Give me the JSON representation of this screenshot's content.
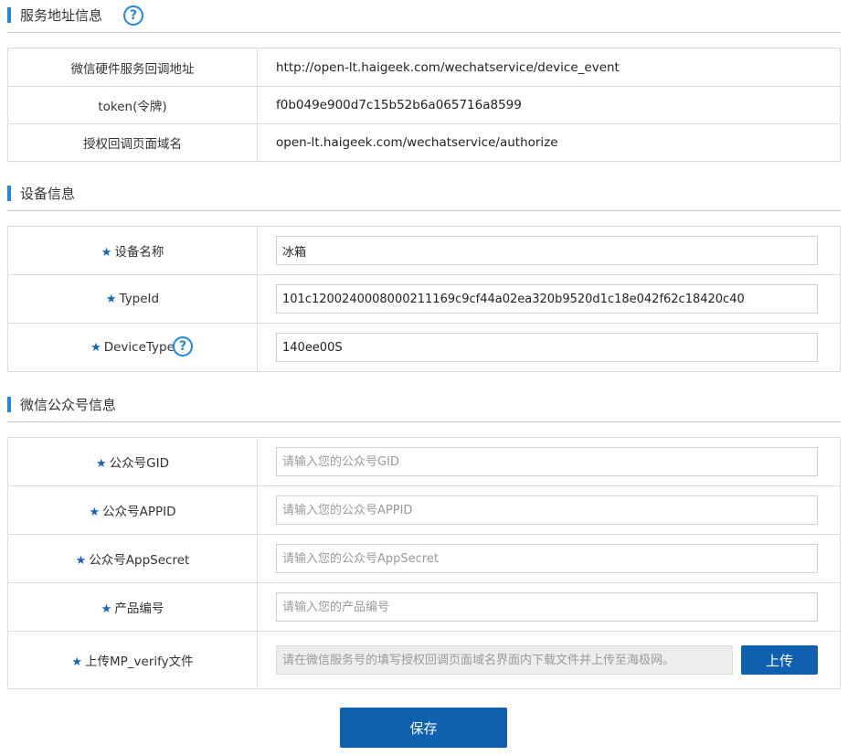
{
  "service": {
    "title": "服务地址信息",
    "rows": [
      {
        "label": "微信硬件服务回调地址",
        "value": "http://open-lt.haigeek.com/wechatservice/device_event"
      },
      {
        "label": "token(令牌)",
        "value": "f0b049e900d7c15b52b6a065716a8599"
      },
      {
        "label": "授权回调页面域名",
        "value": "open-lt.haigeek.com/wechatservice/authorize"
      }
    ]
  },
  "device": {
    "title": "设备信息",
    "name_label": "设备名称",
    "name_value": "冰箱",
    "typeid_label": "TypeId",
    "typeid_value": "101c1200240008000211169c9cf44a02ea320b9520d1c18e042f62c18420c40",
    "devicetype_label": "DeviceType",
    "devicetype_value": "140ee00S"
  },
  "wechat": {
    "title": "微信公众号信息",
    "gid_label": "公众号GID",
    "gid_placeholder": "请输入您的公众号GID",
    "appid_label": "公众号APPID",
    "appid_placeholder": "请输入您的公众号APPID",
    "appsecret_label": "公众号AppSecret",
    "appsecret_placeholder": "请输入您的公众号AppSecret",
    "product_label": "产品编号",
    "product_placeholder": "请输入您的产品编号",
    "upload_label": "上传MP_verify文件",
    "upload_placeholder": "请在微信服务号的填写授权回调页面域名界面内下载文件并上传至海极网。",
    "upload_button": "上传"
  },
  "icons": {
    "help": "?",
    "star": "★"
  },
  "save_button": "保存",
  "colors": {
    "accent": "#1e88e5",
    "button": "#1060b0",
    "star": "#1565c0"
  }
}
